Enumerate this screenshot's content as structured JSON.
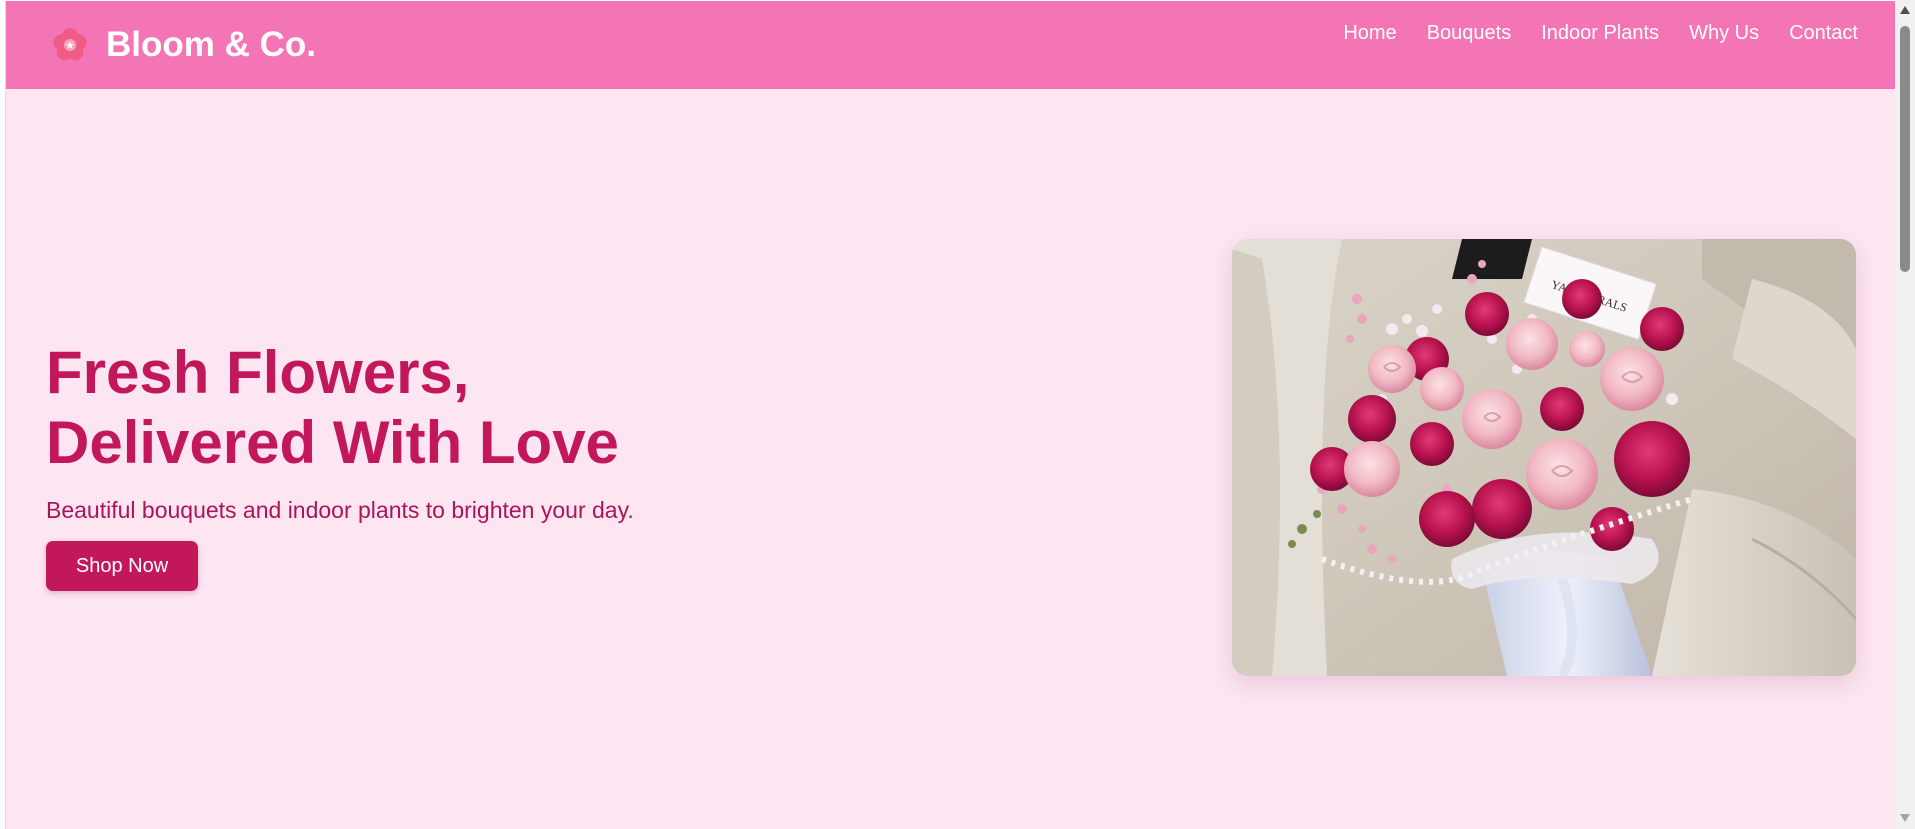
{
  "header": {
    "brand_name": "Bloom & Co.",
    "brand_icon": "cherry-blossom-icon",
    "background_color": "#f475b5"
  },
  "nav": {
    "items": [
      {
        "label": "Home"
      },
      {
        "label": "Bouquets"
      },
      {
        "label": "Indoor Plants"
      },
      {
        "label": "Why Us"
      },
      {
        "label": "Contact"
      }
    ]
  },
  "hero": {
    "title_line1": "Fresh Flowers,",
    "title_line2": "Delivered With Love",
    "subtitle": "Beautiful bouquets and indoor plants to brighten your day.",
    "cta_label": "Shop Now",
    "image_card_text": "YAS FLORALS",
    "background_color": "#fde6f2",
    "accent_color": "#c2185b"
  }
}
